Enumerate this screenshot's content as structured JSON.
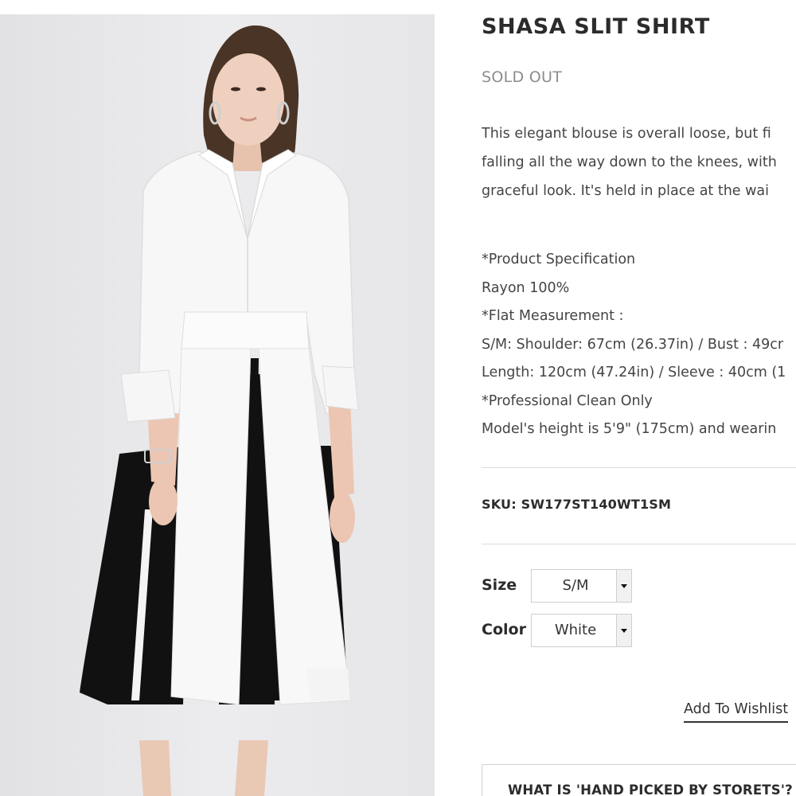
{
  "product": {
    "title": "SHASA SLIT SHIRT",
    "status": "SOLD OUT",
    "description_lines": [
      "This elegant blouse is overall loose, but fi",
      "falling all the way down to the knees, with",
      "graceful look. It's held in place at the wai"
    ],
    "spec_lines": [
      "*Product Specification",
      "Rayon 100%",
      "*Flat Measurement :",
      "S/M: Shoulder: 67cm (26.37in) / Bust : 49cr",
      "Length: 120cm (47.24in) / Sleeve : 40cm (1",
      "*Professional Clean Only",
      "Model's height is 5'9\" (175cm) and wearin"
    ],
    "sku": "SKU: SW177ST140WT1SM",
    "options": {
      "size_label": "Size",
      "size_value": "S/M",
      "color_label": "Color",
      "color_value": "White"
    },
    "wishlist_label": "Add To Wishlist",
    "hand_picked_label": "WHAT IS 'HAND PICKED BY STORETS'?"
  },
  "image": {
    "semantic": "model-wearing-white-slit-shirt-over-black-skirt"
  },
  "colors": {
    "title": "#2b2b2b",
    "status": "#8c8c8c",
    "text": "#444444",
    "divider": "#dcdcdc",
    "photo_background": "#e8e8ea"
  }
}
